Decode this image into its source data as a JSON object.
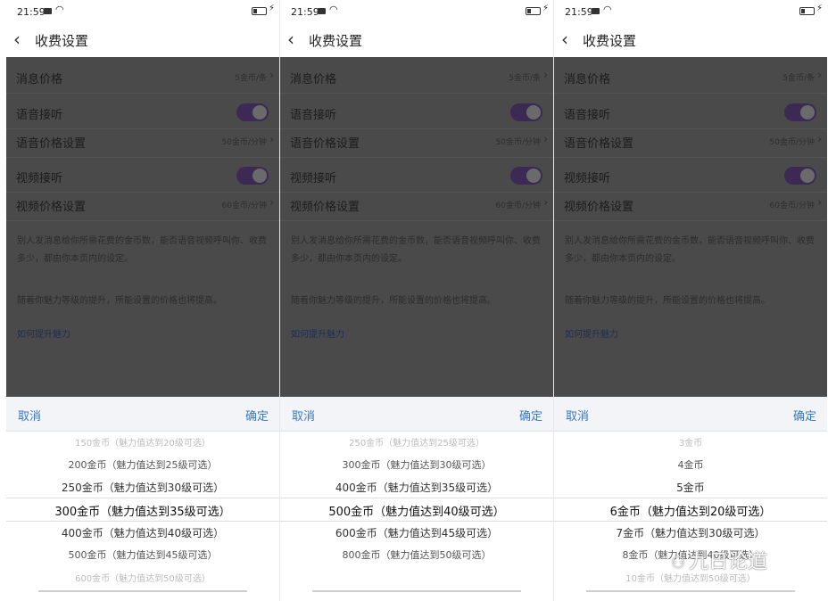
{
  "status_bar": {
    "time": "21:59",
    "wifi_icon": "wifi-icon",
    "battery_icon": "battery-icon"
  },
  "header": {
    "title": "收费设置",
    "back_icon": "chevron-left-icon"
  },
  "settings": {
    "message_price": {
      "label": "消息价格",
      "value": "5金币/条"
    },
    "voice_answer": {
      "label": "语音接听",
      "enabled": true
    },
    "voice_price": {
      "label": "语音价格设置",
      "value": "50金币/分钟"
    },
    "video_answer": {
      "label": "视频接听",
      "enabled": true
    },
    "video_price": {
      "label": "视频价格设置",
      "value": "60金币/分钟"
    },
    "note1": "别人发消息给你所需花费的金币数，能否语音视频呼叫你、收费多少，都由你本页内的设定。",
    "note2": "随着你魅力等级的提升，所能设置的价格也将提高。",
    "link": "如何提升魅力"
  },
  "picker": {
    "cancel_label": "取消",
    "confirm_label": "确定",
    "panels": [
      {
        "options": [
          "150金币（魅力值达到20级可选）",
          "200金币（魅力值达到25级可选）",
          "250金币（魅力值达到30级可选）",
          "300金币（魅力值达到35级可选）",
          "400金币（魅力值达到40级可选）",
          "500金币（魅力值达到45级可选）",
          "600金币（魅力值达到50级可选）"
        ],
        "selected_index": 3
      },
      {
        "options": [
          "250金币（魅力值达到25级可选）",
          "300金币（魅力值达到30级可选）",
          "400金币（魅力值达到35级可选）",
          "500金币（魅力值达到40级可选）",
          "600金币（魅力值达到45级可选）",
          "800金币（魅力值达到50级可选）",
          ""
        ],
        "selected_index": 3
      },
      {
        "options": [
          "3金币",
          "4金币",
          "5金币",
          "6金币（魅力值达到20级可选）",
          "7金币（魅力值达到30级可选）",
          "8金币（魅力值达到40级可选）",
          "10金币（魅力值达到50级可选）"
        ],
        "selected_index": 3
      }
    ]
  },
  "watermark": {
    "text": "九日论道",
    "icon": "wechat-icon"
  },
  "colors": {
    "accent": "#3a78c0",
    "toggle": "#3c2a55",
    "overlay": "#4a4a4a"
  }
}
